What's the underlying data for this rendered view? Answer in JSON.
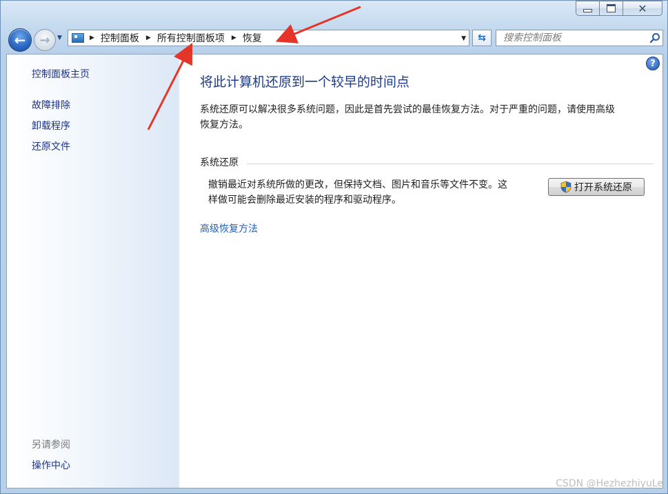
{
  "window": {
    "caption": {
      "minimize": "minimize",
      "maximize": "maximize",
      "close": "close"
    }
  },
  "nav": {
    "breadcrumb": [
      "控制面板",
      "所有控制面板项",
      "恢复"
    ],
    "search_placeholder": "搜索控制面板"
  },
  "sidebar": {
    "home": "控制面板主页",
    "links": [
      "故障排除",
      "卸载程序",
      "还原文件"
    ],
    "see_also_heading": "另请参阅",
    "see_also_link": "操作中心"
  },
  "main": {
    "title": "将此计算机还原到一个较早的时间点",
    "description_line1": "系统还原可以解决很多系统问题，因此是首先尝试的最佳恢复方法。对于严重的问题，请使用高级",
    "description_line2": "恢复方法。",
    "section_heading": "系统还原",
    "section_line1": "撤销最近对系统所做的更改，但保持文档、图片和音乐等文件不变。这",
    "section_line2": "样做可能会删除最近安装的程序和驱动程序。",
    "open_button": "打开系统还原",
    "advanced_link": "高级恢复方法",
    "help_glyph": "?"
  },
  "watermark": "CSDN @HezhezhiyuLe",
  "colors": {
    "link": "#1e3287",
    "title": "#1e3b8a",
    "annotation_arrow": "#e53528"
  }
}
